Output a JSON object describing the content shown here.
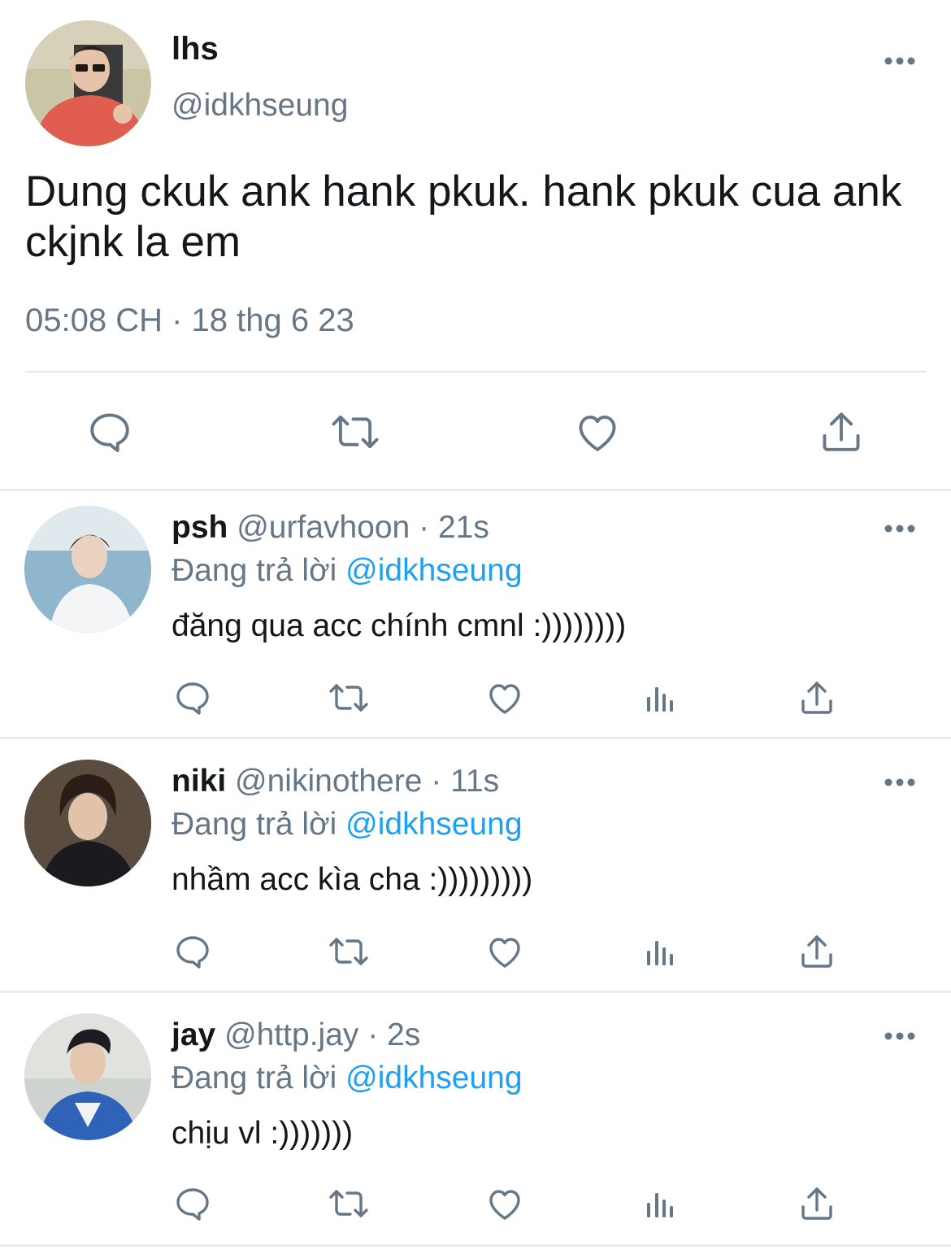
{
  "main_tweet": {
    "name": "lhs",
    "handle": "@idkhseung",
    "text": "Dung ckuk ank hank pkuk. hank pkuk cua ank ckjnk la em",
    "meta": "05:08 CH · 18 thg 6 23",
    "actions": [
      "reply-icon",
      "retweet-icon",
      "like-icon",
      "share-icon"
    ]
  },
  "replies": [
    {
      "name": "psh",
      "handle": "@urfavhoon",
      "separator": "·",
      "time": "21s",
      "reply_prefix": "Đang trả lời",
      "reply_to": "@idkhseung",
      "text": "đăng qua acc chính cmnl :))))))))"
    },
    {
      "name": "niki",
      "handle": "@nikinothere",
      "separator": "·",
      "time": "11s",
      "reply_prefix": "Đang trả lời",
      "reply_to": "@idkhseung",
      "text": "nhầm acc kìa cha :)))))))))"
    },
    {
      "name": "jay",
      "handle": "@http.jay",
      "separator": "·",
      "time": "2s",
      "reply_prefix": "Đang trả lời",
      "reply_to": "@idkhseung",
      "text": "chịu vl :)))))))"
    }
  ],
  "colors": {
    "text": "#14171a",
    "secondary": "#657786",
    "link": "#1da1f2",
    "divider": "#e1e8ed"
  }
}
